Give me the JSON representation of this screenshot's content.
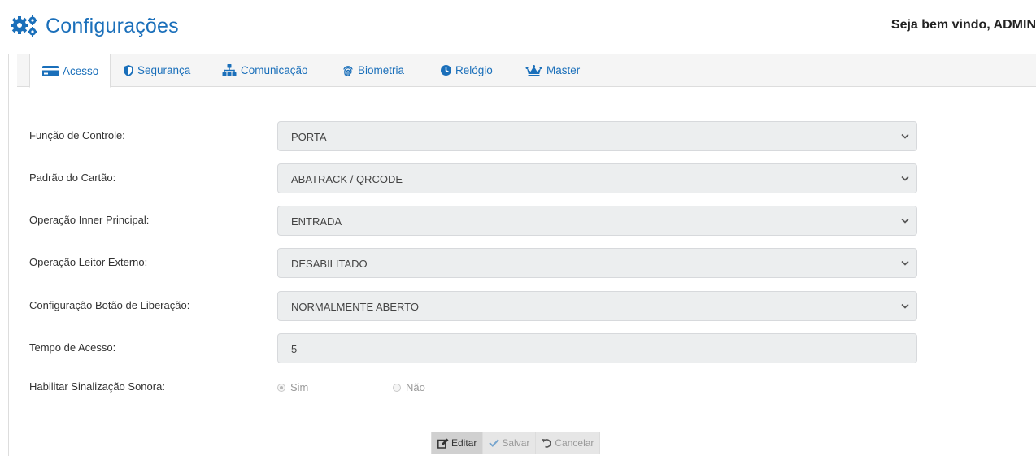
{
  "header": {
    "title": "Configurações",
    "title_icon": "cogs-icon",
    "welcome": "Seja bem vindo, ADMIN"
  },
  "tabs": [
    {
      "label": "Acesso",
      "icon": "credit-card-icon",
      "active": true
    },
    {
      "label": "Segurança",
      "icon": "shield-icon",
      "active": false
    },
    {
      "label": "Comunicação",
      "icon": "sitemap-icon",
      "active": false
    },
    {
      "label": "Biometria",
      "icon": "fingerprint-icon",
      "active": false
    },
    {
      "label": "Relógio",
      "icon": "clock-icon",
      "active": false
    },
    {
      "label": "Master",
      "icon": "crown-icon",
      "active": false
    }
  ],
  "form": {
    "funcao_controle": {
      "label": "Função de Controle:",
      "value": "PORTA"
    },
    "padrao_cartao": {
      "label": "Padrão do Cartão:",
      "value": "ABATRACK / QRCODE"
    },
    "operacao_inner": {
      "label": "Operação Inner Principal:",
      "value": "ENTRADA"
    },
    "operacao_leitor": {
      "label": "Operação Leitor Externo:",
      "value": "DESABILITADO"
    },
    "config_botao": {
      "label": "Configuração Botão de Liberação:",
      "value": "NORMALMENTE ABERTO"
    },
    "tempo_acesso": {
      "label": "Tempo de Acesso:",
      "value": "5"
    },
    "sinalizacao": {
      "label": "Habilitar Sinalização Sonora:",
      "options": [
        "Sim",
        "Não"
      ],
      "selected": "Sim"
    }
  },
  "actions": {
    "edit": "Editar",
    "save": "Salvar",
    "cancel": "Cancelar"
  },
  "colors": {
    "accent": "#1a6fba",
    "field_bg": "#eceeef"
  }
}
